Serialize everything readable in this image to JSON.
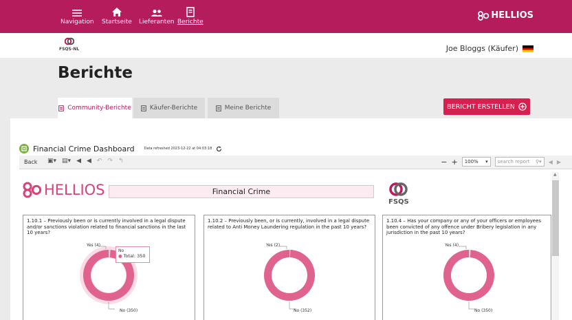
{
  "nav": {
    "items": [
      {
        "label": "Navigation",
        "icon": "menu-icon"
      },
      {
        "label": "Startseite",
        "icon": "home-icon"
      },
      {
        "label": "Lieferanten",
        "icon": "suppliers-icon"
      },
      {
        "label": "Berichte",
        "icon": "reports-icon"
      }
    ],
    "brand": "HELLIOS"
  },
  "org": {
    "logo_caption": "FSQS-NL"
  },
  "user": {
    "name": "Joe Bloggs (Käufer)",
    "flag": "german-flag-icon"
  },
  "page": {
    "title": "Berichte"
  },
  "tabs": [
    {
      "label": "Community-Berichte"
    },
    {
      "label": "Käufer-Berichte"
    },
    {
      "label": "Meine Berichte"
    }
  ],
  "create_button": {
    "label": "BERICHT ERSTELLEN"
  },
  "dashboard": {
    "title": "Financial Crime Dashboard",
    "refreshed": "Data refreshed 2023-12-22 at 04:03:18"
  },
  "toolbar": {
    "back": "Back",
    "zoom": "100%",
    "search_placeholder": "search report"
  },
  "report": {
    "brand": "HELLIOS",
    "title": "Financial Crime",
    "fsqs_caption": "FSQS",
    "questions": [
      {
        "text": "1.10.1 – Previously been or is currently involved in a legal dispute and/or sanctions violation related to financial sanctions in the last 10 years?",
        "yes_label": "Yes (4)",
        "no_label": "No (350)"
      },
      {
        "text": "1.10.2 – Previously been, or is currently, involved in a legal dispute related to Anti Money Laundering regulation in the past 10 years?",
        "yes_label": "Yes (2)",
        "no_label": "No (352)"
      },
      {
        "text": "1.10.4 – Has your company or any of your officers or employees been convicted of any offence under Bribery legislation in any jurisdiction in the past 10 years?",
        "yes_label": "Yes (4)",
        "no_label": "No (350)"
      }
    ],
    "tooltip": {
      "title": "No",
      "value": "Total: 350"
    }
  },
  "chart_data": [
    {
      "type": "pie",
      "categories": [
        "Yes",
        "No"
      ],
      "values": [
        4,
        350
      ]
    },
    {
      "type": "pie",
      "categories": [
        "Yes",
        "No"
      ],
      "values": [
        2,
        352
      ]
    },
    {
      "type": "pie",
      "categories": [
        "Yes",
        "No"
      ],
      "values": [
        4,
        350
      ]
    }
  ],
  "colors": {
    "brand": "#b41c5c",
    "no_slice": "#e0628f",
    "yes_slice": "#f6c6d6"
  }
}
